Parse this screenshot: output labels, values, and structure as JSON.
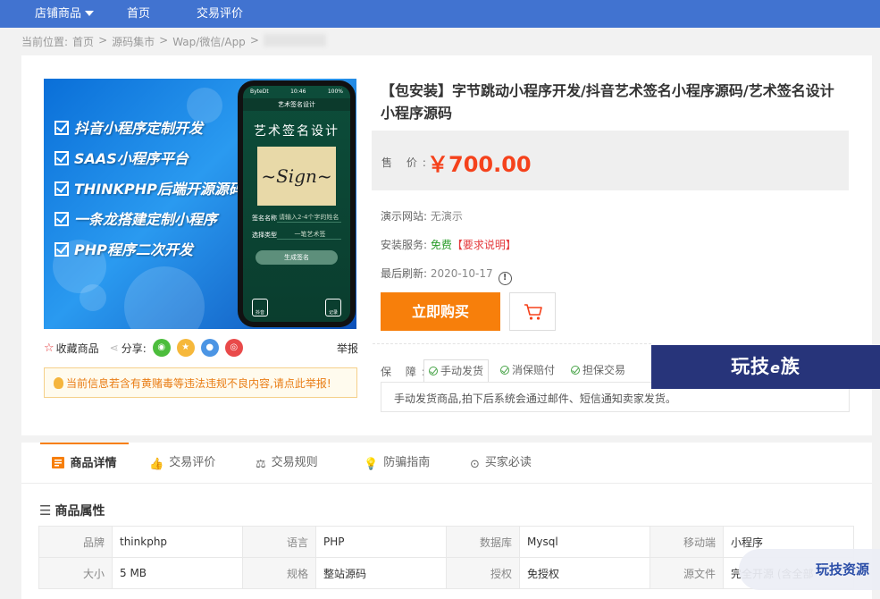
{
  "nav": {
    "shop_goods": "店铺商品",
    "home": "首页",
    "reviews": "交易评价"
  },
  "breadcrumb": {
    "label": "当前位置:",
    "items": [
      "首页",
      "源码集市",
      "Wap/微信/App"
    ],
    "sep": ">"
  },
  "product_image": {
    "features": [
      "抖音小程序定制开发",
      "SAAS小程序平台",
      "THINKPHP后端开源源码",
      "一条龙搭建定制小程序",
      "PHP程序二次开发"
    ],
    "phone": {
      "app_name": "艺术签名设计",
      "title": "艺术签名设计",
      "row1_k": "签名名称",
      "row1_v": "请输入2-4个字的姓名",
      "row2_k": "选择类型",
      "row2_v": "一笔艺术签",
      "button": "生成签名",
      "tab1": "抖音",
      "tab2": "记录",
      "time": "10:46",
      "carrier": "ByteDt",
      "battery": "100%"
    }
  },
  "actions": {
    "favorite": "收藏商品",
    "share": "分享:",
    "report": "举报"
  },
  "warning": "当前信息若含有黄赌毒等违法违规不良内容,请点此举报!",
  "product": {
    "title": "【包安装】字节跳动小程序开发/抖音艺术签名小程序源码/艺术签名设计小程序源码",
    "price_label": "售 价:",
    "price": "￥700.00",
    "demo_label": "演示网站:",
    "demo_value": "无演示",
    "install_label": "安装服务:",
    "install_value": "免费",
    "install_note": "【要求说明】",
    "refresh_label": "最后刷新:",
    "refresh_value": "2020-10-17",
    "buy": "立即购买",
    "guarantee_label": "保 障:",
    "guarantees": [
      "手动发货",
      "消保赔付",
      "担保交易"
    ],
    "guarantee_desc": "手动发货商品,拍下后系统会通过邮件、短信通知卖家发货。"
  },
  "watermark": {
    "top": "玩技",
    "top_e": "e",
    "top_end": "族",
    "bottom": "玩技资源"
  },
  "tabs": [
    "商品详情",
    "交易评价",
    "交易规则",
    "防骗指南",
    "买家必读"
  ],
  "attributes": {
    "heading": "商品属性",
    "rows": [
      [
        [
          "品牌",
          "thinkphp"
        ],
        [
          "语言",
          "PHP"
        ],
        [
          "数据库",
          "Mysql"
        ],
        [
          "移动端",
          "小程序"
        ]
      ],
      [
        [
          "大小",
          "5 MB"
        ],
        [
          "规格",
          "整站源码"
        ],
        [
          "授权",
          "免授权"
        ],
        [
          "源文件",
          "完全开源 (含全部"
        ]
      ]
    ]
  },
  "colors": {
    "nav_bg": "#4173d0",
    "accent": "#f77f0b",
    "price": "#f5421c"
  }
}
